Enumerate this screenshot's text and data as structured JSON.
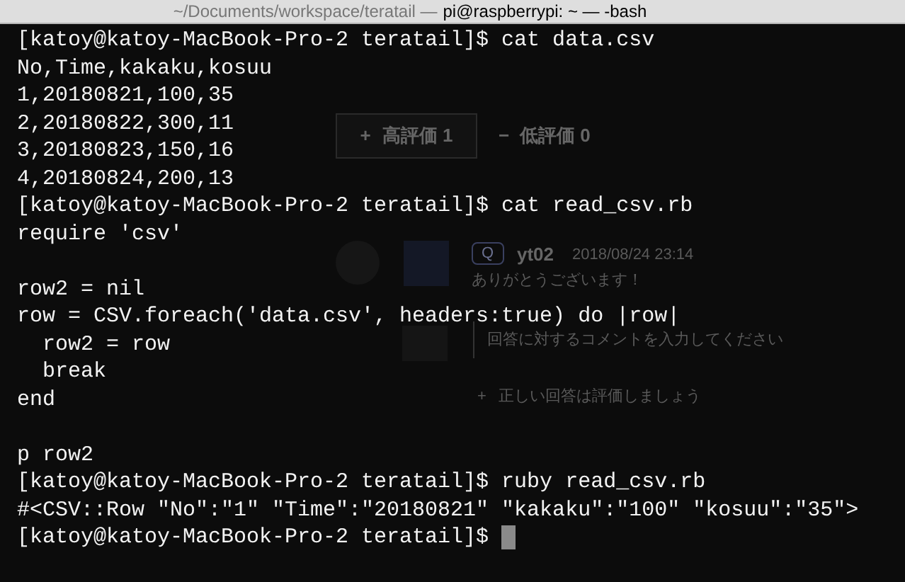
{
  "window": {
    "title_path": "~/Documents/workspace/teratail —",
    "title_session": "pi@raspberrypi: ~ — -bash"
  },
  "terminal": {
    "lines": [
      "[katoy@katoy-MacBook-Pro-2 teratail]$ cat data.csv",
      "No,Time,kakaku,kosuu",
      "1,20180821,100,35",
      "2,20180822,300,11",
      "3,20180823,150,16",
      "4,20180824,200,13",
      "[katoy@katoy-MacBook-Pro-2 teratail]$ cat read_csv.rb",
      "require 'csv'",
      {
        "text": "row2 = nil",
        "blank_line_before": true
      },
      "row = CSV.foreach('data.csv', headers:true) do |row|",
      "  row2 = row",
      "  break",
      "end",
      {
        "text": "p row2",
        "blank_line_before": true
      },
      "[katoy@katoy-MacBook-Pro-2 teratail]$ ruby read_csv.rb",
      "#<CSV::Row \"No\":\"1\" \"Time\":\"20180821\" \"kakaku\":\"100\" \"kosuu\":\"35\">",
      "[katoy@katoy-MacBook-Pro-2 teratail]$ "
    ],
    "cursor": true
  },
  "background_page": {
    "upvote": {
      "icon": "+",
      "label": "高評価 1"
    },
    "downvote": {
      "icon": "−",
      "label": "低評価 0"
    },
    "comment": {
      "badge": "Q",
      "user": "yt02",
      "time": "2018/08/24 23:14",
      "text": "ありがとうございます！"
    },
    "comment_field": {
      "placeholder": "回答に対するコメントを入力してください"
    },
    "hint": {
      "icon": "+",
      "text": "正しい回答は評価しましょう"
    }
  }
}
